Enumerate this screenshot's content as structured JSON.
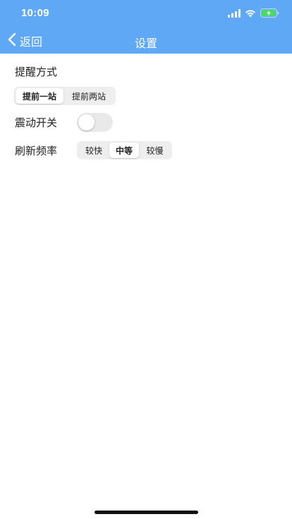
{
  "status_bar": {
    "time": "10:09"
  },
  "nav": {
    "back_label": "返回",
    "title": "设置"
  },
  "settings": {
    "reminder": {
      "label": "提醒方式",
      "options": [
        "提前一站",
        "提前两站"
      ],
      "selected_index": 0
    },
    "vibration": {
      "label": "震动开关",
      "on": false
    },
    "refresh": {
      "label": "刷新频率",
      "options": [
        "较快",
        "中等",
        "较慢"
      ],
      "selected_index": 1
    }
  },
  "colors": {
    "header": "#5ea8f5",
    "battery_fill": "#4cd964",
    "toggle_off": "#e9e9ea"
  },
  "icons": [
    "signal-icon",
    "wifi-icon",
    "battery-charging-icon",
    "chevron-left-icon"
  ]
}
